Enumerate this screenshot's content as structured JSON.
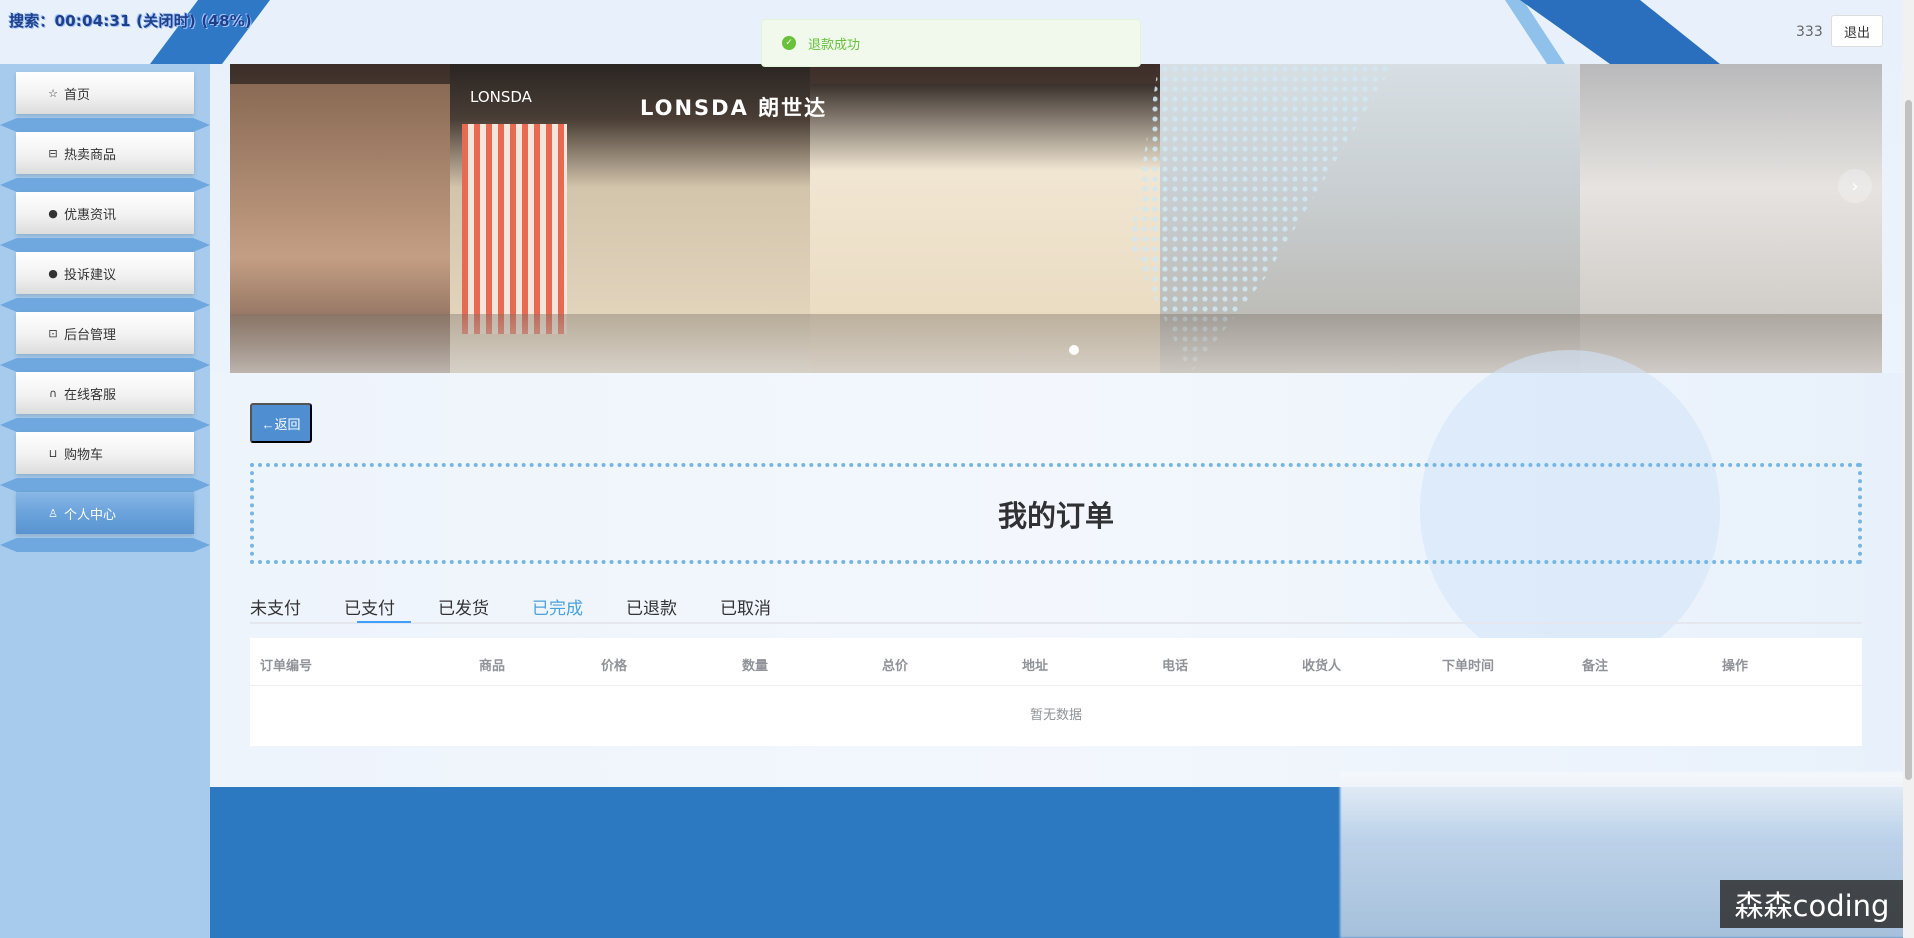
{
  "timer": "搜索：00:04:31 (关闭时) (48%)",
  "header": {
    "username": "333",
    "logout_label": "退出"
  },
  "toast": {
    "message": "退款成功",
    "type": "success",
    "color": "#67c23a"
  },
  "sidebar": {
    "items": [
      {
        "label": "首页",
        "icon": "star-icon"
      },
      {
        "label": "热卖商品",
        "icon": "bag-icon"
      },
      {
        "label": "优惠资讯",
        "icon": "info-icon"
      },
      {
        "label": "投诉建议",
        "icon": "question-icon"
      },
      {
        "label": "后台管理",
        "icon": "briefcase-icon"
      },
      {
        "label": "在线客服",
        "icon": "headset-icon"
      },
      {
        "label": "购物车",
        "icon": "cart-icon"
      },
      {
        "label": "个人中心",
        "icon": "user-icon",
        "active": true
      }
    ]
  },
  "banner": {
    "brand_small": "LONSDA",
    "brand_large": "LONSDA 朗世达",
    "next_icon": "chevron-right-icon"
  },
  "back_label": "←返回",
  "page_title": "我的订单",
  "tabs": [
    {
      "label": "未支付"
    },
    {
      "label": "已支付",
      "active": true
    },
    {
      "label": "已发货"
    },
    {
      "label": "已完成",
      "highlighted": true
    },
    {
      "label": "已退款"
    },
    {
      "label": "已取消"
    }
  ],
  "table": {
    "columns": [
      "订单编号",
      "商品",
      "价格",
      "数量",
      "总价",
      "地址",
      "电话",
      "收货人",
      "下单时间",
      "备注",
      "操作"
    ],
    "empty_text": "暂无数据"
  },
  "watermark": "森森coding",
  "colors": {
    "accent": "#409eff",
    "sidebar_bg": "#a6cbec",
    "footer": "#2c79c1",
    "title_border": "#76b6e4"
  }
}
